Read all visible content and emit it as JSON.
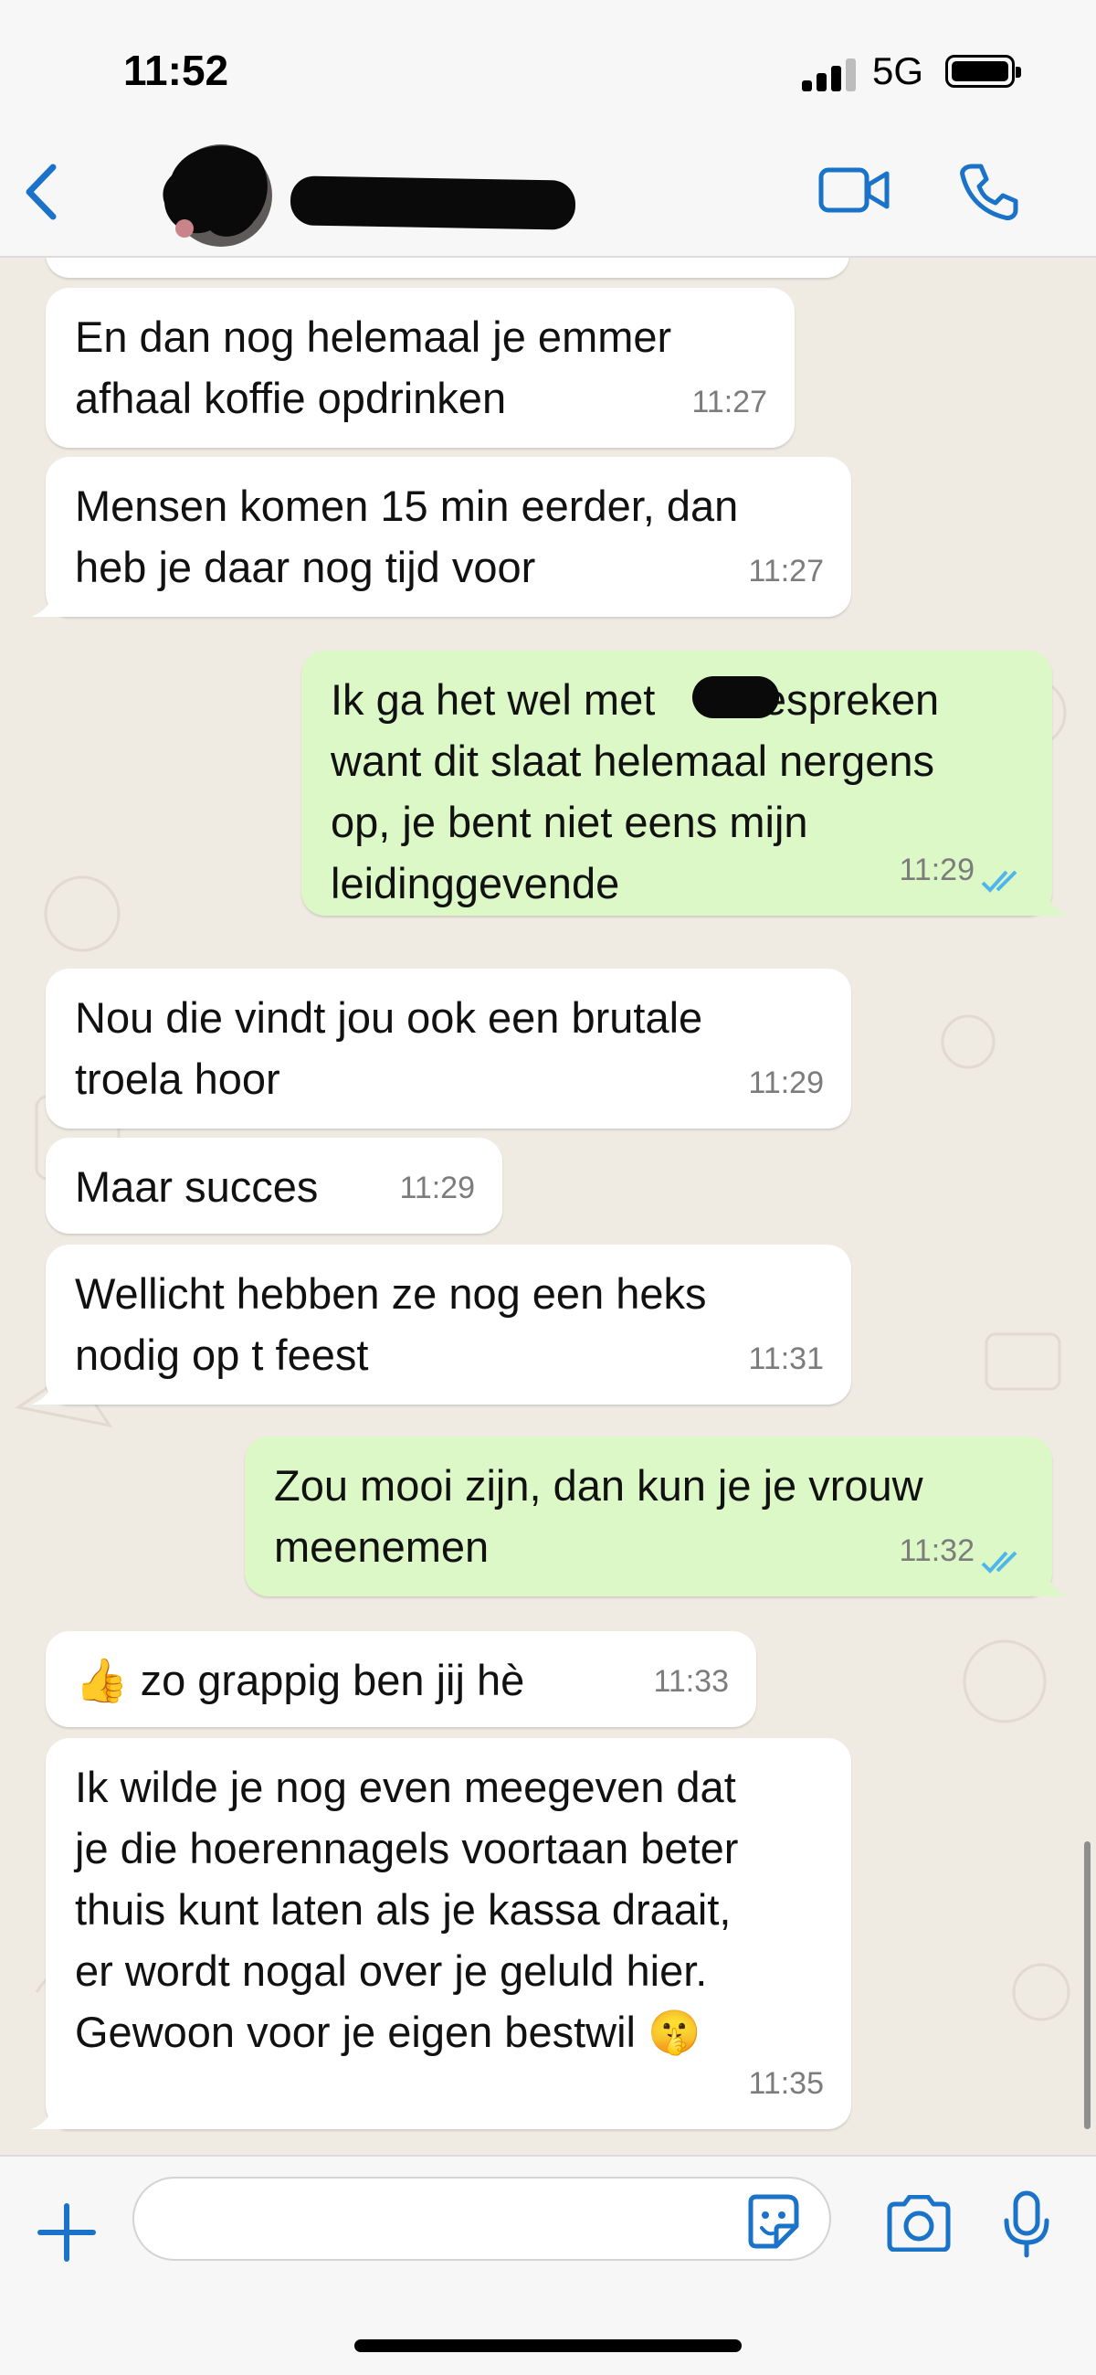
{
  "status_bar": {
    "time": "11:52",
    "network": "5G"
  },
  "chat_header": {
    "contact_name": ""
  },
  "messages": [
    {
      "dir": "in",
      "text": "En dan nog helemaal je emmer\nafhaal koffie opdrinken",
      "time": "11:27"
    },
    {
      "dir": "in",
      "text": "Mensen komen 15 min eerder, dan\nheb je daar nog tijd voor",
      "time": "11:27"
    },
    {
      "dir": "out",
      "text": "Ik ga het wel met       bespreken\nwant dit slaat helemaal nergens\nop, je bent niet eens mijn\nleidinggevende",
      "time": "11:29",
      "status": "read"
    },
    {
      "dir": "in",
      "text": "Nou die vindt jou ook een brutale\ntroela hoor",
      "time": "11:29"
    },
    {
      "dir": "in",
      "text": "Maar succes",
      "time": "11:29"
    },
    {
      "dir": "in",
      "text": "Wellicht hebben ze nog een heks\nnodig op t feest",
      "time": "11:31"
    },
    {
      "dir": "out",
      "text": "Zou mooi zijn, dan kun je je vrouw\nmeenemen",
      "time": "11:32",
      "status": "read"
    },
    {
      "dir": "in",
      "text": "👍 zo grappig ben jij hè",
      "time": "11:33"
    },
    {
      "dir": "in",
      "text": "Ik wilde je nog even meegeven dat\nje die hoerennagels voortaan beter\nthuis kunt laten als je kassa draait,\ner wordt nogal over je geluld hier.\nGewoon voor je eigen bestwil 🤫",
      "time": "11:35"
    }
  ],
  "composer": {
    "placeholder": ""
  },
  "colors": {
    "accent": "#1a73c9",
    "outgoing": "#dcf8c6",
    "incoming": "#ffffff",
    "read_ticks": "#4fb6ec"
  }
}
